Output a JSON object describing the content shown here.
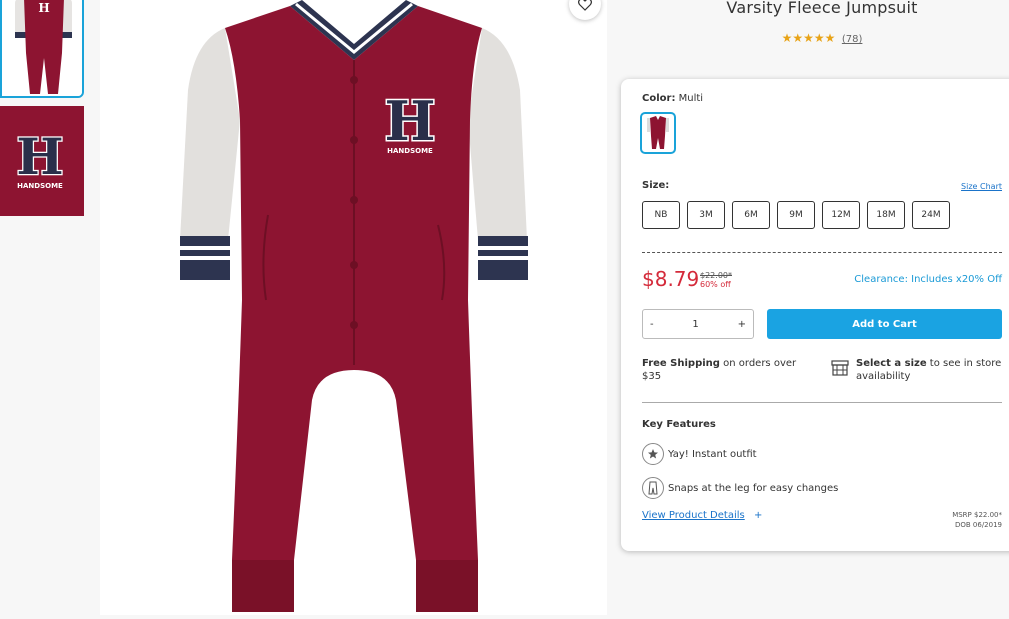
{
  "product": {
    "title": "Varsity Fleece Jumpsuit",
    "stars": "★★★★★",
    "rating_count": "(78)",
    "star_color": "#e8a317"
  },
  "color": {
    "label": "Color:",
    "value": "Multi"
  },
  "size": {
    "label": "Size:",
    "chart_link": "Size Chart",
    "options": [
      "NB",
      "3M",
      "6M",
      "9M",
      "12M",
      "18M",
      "24M"
    ]
  },
  "pricing": {
    "price": "$8.79",
    "original": "$22.00*",
    "percent_off": "60% off",
    "clearance": "Clearance: Includes x20% Off",
    "price_color": "#d42a3a"
  },
  "cart": {
    "minus": "-",
    "quantity": "1",
    "plus": "+",
    "add_label": "Add to Cart",
    "button_color": "#1aa3e2"
  },
  "shipping": {
    "bold": "Free Shipping",
    "text": " on orders over $35"
  },
  "store": {
    "bold": "Select a size",
    "text": " to see in store availability"
  },
  "features": {
    "title": "Key Features",
    "items": [
      "Yay! Instant outfit",
      "Snaps at the leg for easy changes"
    ]
  },
  "details": {
    "link": "View Product Details",
    "plus": "+",
    "msrp": "MSRP $22.00*",
    "dob": "DOB 06/2019"
  },
  "icons": {
    "wishlist": "heart-icon",
    "store": "store-icon",
    "feature_1": "star-badge-icon",
    "feature_2": "snap-legs-icon"
  }
}
